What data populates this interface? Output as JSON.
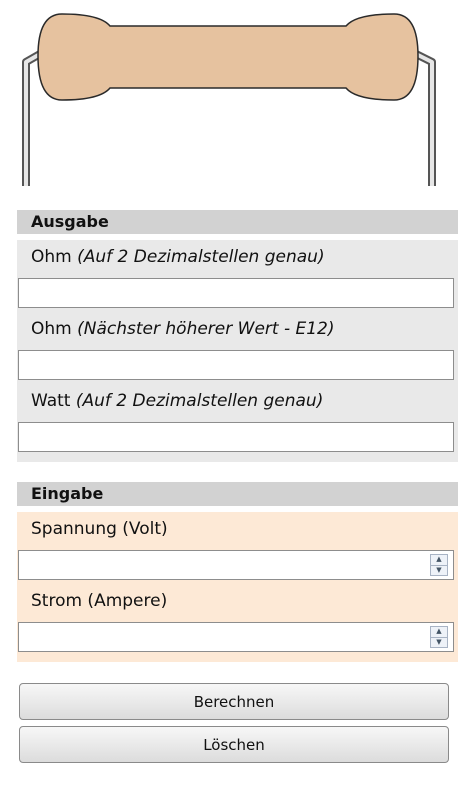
{
  "output": {
    "title": "Ausgabe",
    "ohm": {
      "prefix": "Ohm ",
      "hint": "(Auf 2 Dezimalstellen genau)",
      "value": ""
    },
    "ohm_e12": {
      "prefix": "Ohm ",
      "hint": "(Nächster höherer Wert - E12)",
      "value": ""
    },
    "watt": {
      "prefix": "Watt ",
      "hint": "(Auf 2 Dezimalstellen genau)",
      "value": ""
    }
  },
  "input": {
    "title": "Eingabe",
    "voltage": {
      "label": "Spannung (Volt)",
      "value": ""
    },
    "current": {
      "label": "Strom (Ampere)",
      "value": ""
    }
  },
  "buttons": {
    "calculate": "Berechnen",
    "clear": "Löschen"
  },
  "colors": {
    "resistor_body": "#e6c29f",
    "output_bg": "#e9e9e9",
    "input_bg": "#fde9d6",
    "header_bg": "#d2d2d2"
  },
  "icons": {
    "spinner_up": "▲",
    "spinner_down": "▼"
  }
}
